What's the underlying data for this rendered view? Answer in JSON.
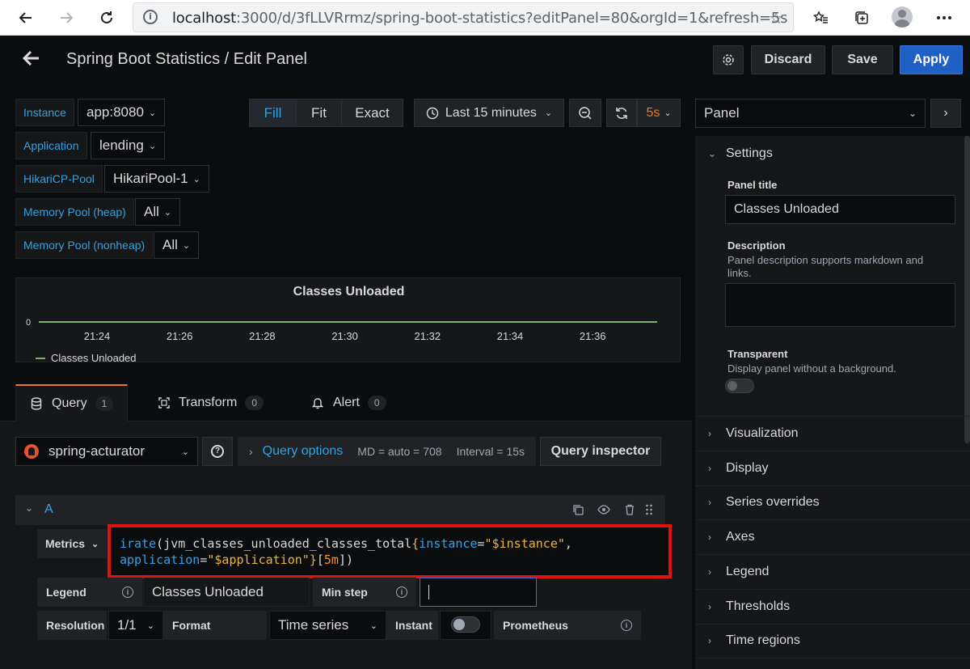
{
  "browser": {
    "url_host": "localhost",
    "url_rest": ":3000/d/3fLLVRrmz/spring-boot-statistics?editPanel=80&orgId=1&refresh=5s"
  },
  "header": {
    "title": "Spring Boot Statistics / Edit Panel",
    "discard_label": "Discard",
    "save_label": "Save",
    "apply_label": "Apply"
  },
  "variables": [
    {
      "label": "Instance",
      "value": "app:8080"
    },
    {
      "label": "Application",
      "value": "lending"
    },
    {
      "label": "HikariCP-Pool",
      "value": "HikariPool-1"
    },
    {
      "label": "Memory Pool (heap)",
      "value": "All"
    },
    {
      "label": "Memory Pool (nonheap)",
      "value": "All"
    }
  ],
  "toolbar": {
    "fill": "Fill",
    "fit": "Fit",
    "exact": "Exact",
    "time_range": "Last 15 minutes",
    "refresh": "5s"
  },
  "preview": {
    "title": "Classes Unloaded",
    "y_tick": "0",
    "x_ticks": [
      "21:24",
      "21:26",
      "21:28",
      "21:30",
      "21:32",
      "21:34",
      "21:36"
    ],
    "legend": "Classes Unloaded",
    "series_color": "#7eb26d"
  },
  "tabs": [
    {
      "label": "Query",
      "count": "1"
    },
    {
      "label": "Transform",
      "count": "0"
    },
    {
      "label": "Alert",
      "count": "0"
    }
  ],
  "query": {
    "datasource": "spring-acturator",
    "options_label": "Query options",
    "md": "MD = auto = 708",
    "interval": "Interval = 15s",
    "inspector_label": "Query inspector",
    "ref": "A",
    "metrics_label": "Metrics",
    "expr_line1": {
      "fn": "irate",
      "metric": "jvm_classes_unloaded_classes_total",
      "lbl1": "instance",
      "val1": "\"$instance\""
    },
    "expr_line2": {
      "lbl2": "application",
      "val2": "\"$application\"",
      "range": "5m"
    },
    "legend_label": "Legend",
    "legend_value": "Classes Unloaded",
    "minstep_label": "Min step",
    "resolution_label": "Resolution",
    "resolution_value": "1/1",
    "format_label": "Format",
    "format_value": "Time series",
    "instant_label": "Instant",
    "prometheus_label": "Prometheus"
  },
  "sidebar": {
    "panel_select": "Panel",
    "settings": "Settings",
    "panel_title_label": "Panel title",
    "panel_title_value": "Classes Unloaded",
    "description_label": "Description",
    "description_help": "Panel description supports markdown and links.",
    "transparent_label": "Transparent",
    "transparent_help": "Display panel without a background.",
    "sections": [
      "Visualization",
      "Display",
      "Series overrides",
      "Axes",
      "Legend",
      "Thresholds",
      "Time regions"
    ]
  }
}
